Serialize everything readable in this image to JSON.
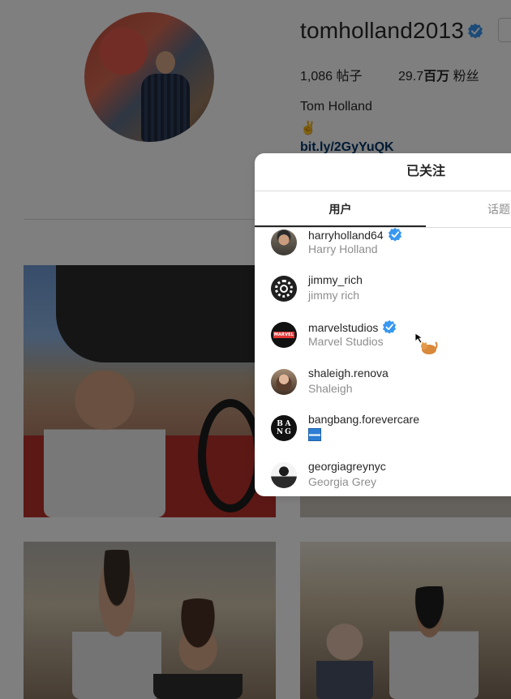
{
  "profile": {
    "username": "tomholland2013",
    "posts_count": "1,086",
    "posts_label": "帖子",
    "followers_count": "29.7",
    "followers_unit": "百万",
    "followers_label": "粉丝",
    "full_name": "Tom Holland",
    "bio_emoji": "✌",
    "bio_link": "bit.ly/2GyYuQK"
  },
  "modal": {
    "title": "已关注",
    "tabs": [
      {
        "label": "用户",
        "active": true
      },
      {
        "label": "话题",
        "active": false
      }
    ],
    "users": [
      {
        "handle": "harryholland64",
        "full_name": "Harry Holland",
        "verified": true,
        "avatar": "photo-avatar"
      },
      {
        "handle": "jimmy_rich",
        "full_name": "jimmy rich",
        "verified": false,
        "avatar": "reactor-logo-avatar"
      },
      {
        "handle": "marvelstudios",
        "full_name": "Marvel Studios",
        "verified": true,
        "avatar": "marvel-logo-avatar"
      },
      {
        "handle": "shaleigh.renova",
        "full_name": "Shaleigh",
        "verified": false,
        "avatar": "photo-avatar"
      },
      {
        "handle": "bangbang.forevercare",
        "full_name": "",
        "verified": false,
        "avatar": "bangbang-logo-avatar",
        "subtitle_icon": "flag-icon"
      },
      {
        "handle": "georgiagreynyc",
        "full_name": "Georgia Grey",
        "verified": false,
        "avatar": "photo-avatar"
      }
    ],
    "marvel_logo_text": "MARVEL STUDIOS",
    "bangbang_logo_letters": [
      "B",
      "A",
      "N",
      "G"
    ]
  },
  "colors": {
    "verified_blue": "#3897f0",
    "link_color": "#003569",
    "secondary_text": "#8e8e8e",
    "overlay": "rgba(0,0,0,0.5)"
  },
  "icons": {
    "verified": "verified-badge-icon",
    "cursor": "pointer-cursor-icon"
  }
}
